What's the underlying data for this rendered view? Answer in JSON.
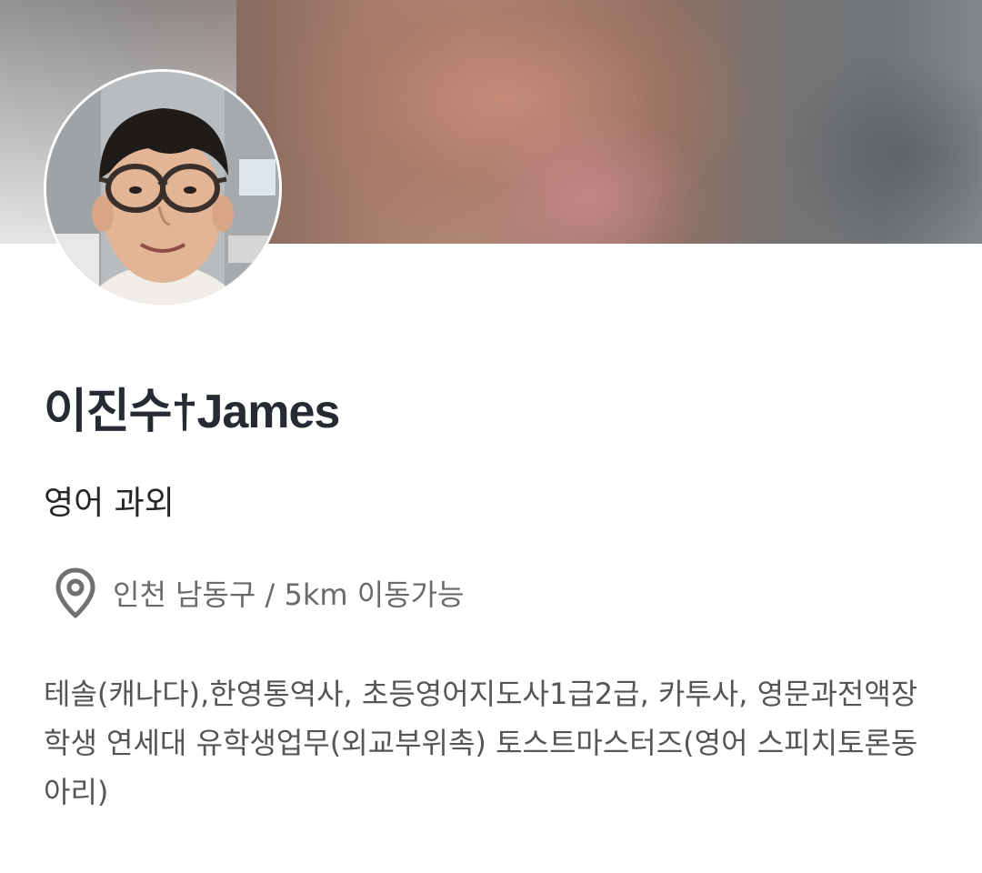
{
  "profile": {
    "name": "이진수†James",
    "subtitle": "영어 과외",
    "location": "인천 남동구 / 5km 이동가능",
    "bio": "테솔(캐나다),한영통역사, 초등영어지도사1급2급, 카투사, 영문과전액장학생 연세대 유학생업무(외교부위촉) 토스트마스터즈(영어 스피치토론동아리)"
  },
  "icons": {
    "location": "location-pin-icon"
  },
  "colors": {
    "name_text": "#262a33",
    "subtitle_text": "#262626",
    "location_text": "#6a6a6a",
    "bio_text": "#555555",
    "icon": "#707070"
  }
}
